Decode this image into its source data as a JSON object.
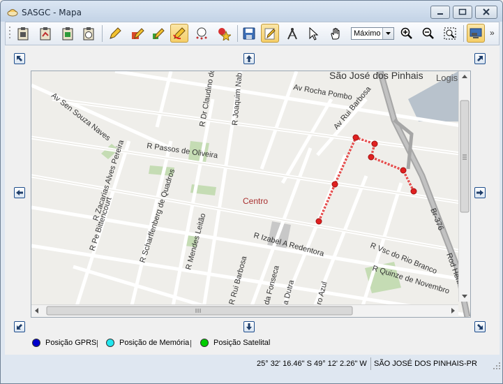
{
  "window": {
    "title": "SASGC - Mapa"
  },
  "toolbar": {
    "zoom_value": "Máximo",
    "more_label": "»"
  },
  "map": {
    "labels": {
      "city": "São José dos Pinhais",
      "logis": "Logis",
      "av_rocha_pombo": "Av Rocha Pombo",
      "av_rui_barbosa": "Av Rui Barbosa",
      "av_sen_souza_naves": "Av Sen Souza Naves",
      "r_dr_claudino": "R Dr Claudino do",
      "r_joaquim_nab": "R Joaquim Nab",
      "r_passos_oliveira": "R Passos de Oliveira",
      "r_zacarias": "R Zacarias Alves Pereira",
      "r_pe_bittencourt": "R Pe Bittencourt",
      "r_scharffenberg": "R Scharffenberg de Quadros",
      "r_mendes_leitao": "R Mendes Leitão",
      "centro": "Centro",
      "r_izabel": "R Izabel A Redentora",
      "r_rui_barbosa": "R Rui Barbosa",
      "da_fonseca": "da Fonseca",
      "a_dutra": "a Dutra",
      "ro_azul": "ro Azul",
      "r_vsc_rio_branco": "R Vsc do Rio Branco",
      "r_quinze": "R Quinze de Novembro",
      "br_376": "Br-376",
      "rod_henr": "Rod Henr"
    }
  },
  "legend": {
    "gprs_label": "Posição GPRS",
    "memoria_label": "Posição de Memória",
    "satelital_label": "Posição Satelital",
    "separator": "|",
    "colors": {
      "gprs": "#0000cc",
      "memoria": "#22e6ee",
      "satelital": "#00cc00"
    }
  },
  "status": {
    "coordinates": "25° 32' 16.46\" S 49° 12' 2.26\" W",
    "city": "SÃO JOSÉ DOS PINHAIS-PR"
  },
  "route_color": "#e02020"
}
